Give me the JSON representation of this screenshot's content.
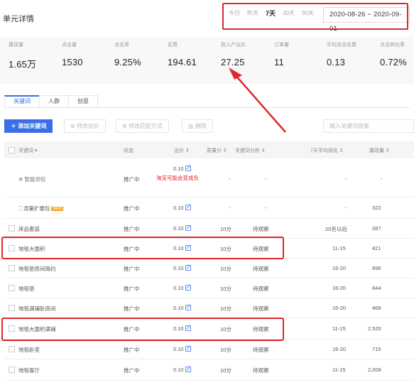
{
  "header": {
    "title": "单元详情",
    "ranges": [
      "今日",
      "昨天",
      "7天",
      "30天",
      "90天"
    ],
    "active_range": "7天",
    "date_range": "2020-08-26 ~ 2020-09-01"
  },
  "metrics": [
    {
      "label": "展现量",
      "value": "1.65万"
    },
    {
      "label": "点击量",
      "value": "1530"
    },
    {
      "label": "点击率",
      "value": "9.25%"
    },
    {
      "label": "花费",
      "value": "194.61"
    },
    {
      "label": "投入产出比",
      "value": "27.25"
    },
    {
      "label": "订单量",
      "value": "11"
    },
    {
      "label": "平均点击花费",
      "value": "0.13"
    },
    {
      "label": "点击转化率",
      "value": "0.72%"
    }
  ],
  "tabs": [
    "关键词",
    "人群",
    "创意"
  ],
  "toolbar": {
    "add": "添加关键词",
    "edit_bid": "修改出价",
    "edit_match": "修改匹配方式",
    "delete": "删除",
    "search_placeholder": "输入关键词搜索"
  },
  "columns": {
    "keyword": "关键词",
    "status": "状态",
    "bid": "出价",
    "quality": "质量分",
    "competition": "关键词分析",
    "rank": "7天平均排名",
    "impressions": "展现量"
  },
  "rows": [
    {
      "keyword": "智能词包",
      "status": "推广中",
      "bid": "0.10",
      "quality": "-",
      "competition": "-",
      "rank": "-",
      "impressions": "-",
      "note": "淘宝可能会变成负"
    },
    {
      "keyword": "流量扩展包",
      "tag": "NEW",
      "status": "推广中",
      "bid": "0.10",
      "quality": "-",
      "competition": "-",
      "rank": "-",
      "impressions": "322"
    },
    {
      "keyword": "床品套装",
      "status": "推广中",
      "bid": "0.10",
      "quality": "10分",
      "competition": "待观察",
      "rank": "20名以后",
      "impressions": "287"
    },
    {
      "keyword": "地毯大面积",
      "status": "推广中",
      "bid": "0.10",
      "quality": "10分",
      "competition": "待观察",
      "rank": "11-15",
      "impressions": "421"
    },
    {
      "keyword": "地毯垫房间简约",
      "status": "推广中",
      "bid": "0.10",
      "quality": "10分",
      "competition": "待观察",
      "rank": "16-20",
      "impressions": "896"
    },
    {
      "keyword": "地毯垫",
      "status": "推广中",
      "bid": "0.10",
      "quality": "10分",
      "competition": "待观察",
      "rank": "16-20",
      "impressions": "844"
    },
    {
      "keyword": "地毯满铺卧房间",
      "status": "推广中",
      "bid": "0.10",
      "quality": "10分",
      "competition": "待观察",
      "rank": "16-20",
      "impressions": "468"
    },
    {
      "keyword": "地毯大面积满铺",
      "status": "推广中",
      "bid": "0.10",
      "quality": "10分",
      "competition": "待观察",
      "rank": "11-15",
      "impressions": "2,520"
    },
    {
      "keyword": "地毯卧室",
      "status": "推广中",
      "bid": "0.10",
      "quality": "10分",
      "competition": "待观察",
      "rank": "16-20",
      "impressions": "715"
    },
    {
      "keyword": "地毯客厅",
      "status": "推广中",
      "bid": "0.10",
      "quality": "10分",
      "competition": "待观察",
      "rank": "11-15",
      "impressions": "2,008"
    }
  ],
  "colors": {
    "accent": "#3a6ee8",
    "highlight": "#e0262b"
  }
}
